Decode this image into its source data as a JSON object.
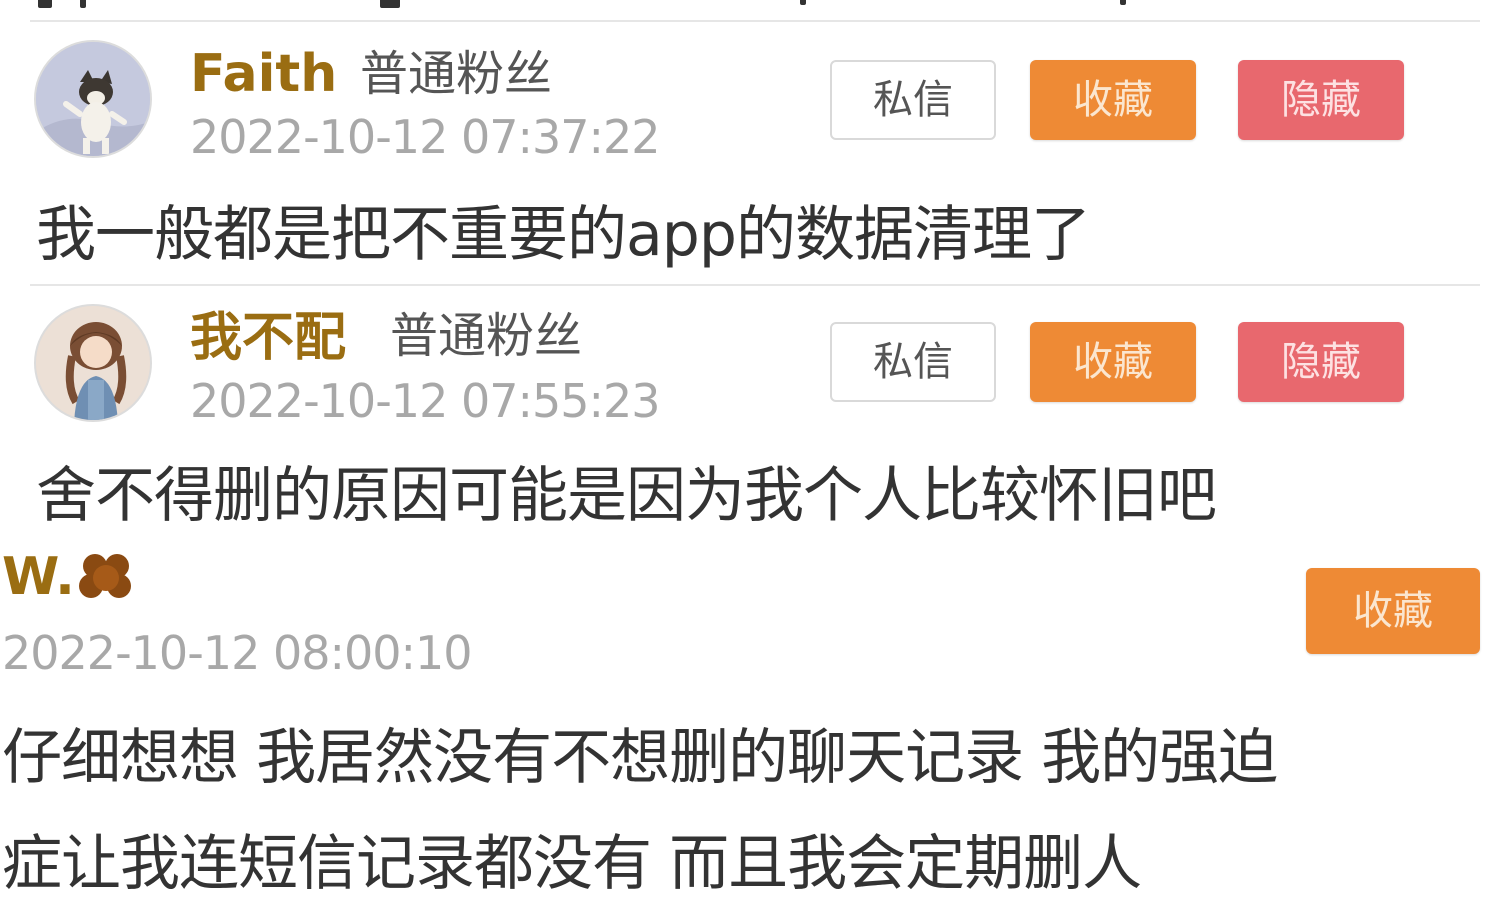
{
  "comments": [
    {
      "username": "Faith",
      "fan_level": "普通粉丝",
      "timestamp": "2022-10-12 07:37:22",
      "content": "我一般都是把不重要的app的数据清理了",
      "buttons": {
        "message": "私信",
        "favorite": "收藏",
        "hide": "隐藏"
      }
    },
    {
      "username": "我不配",
      "fan_level": "普通粉丝",
      "timestamp": "2022-10-12 07:55:23",
      "content": "舍不得删的原因可能是因为我个人比较怀旧吧",
      "buttons": {
        "message": "私信",
        "favorite": "收藏",
        "hide": "隐藏"
      }
    },
    {
      "username": "W.",
      "timestamp": "2022-10-12 08:00:10",
      "content_lines": [
        "仔细想想 我居然没有不想删的聊天记录 我的强迫",
        "症让我连短信记录都没有 而且我会定期删人"
      ],
      "buttons": {
        "favorite": "收藏"
      }
    }
  ],
  "colors": {
    "username": "#9a6d12",
    "favorite_button": "#ee8a35",
    "hide_button": "#e8686e",
    "timestamp": "#a8a8a8"
  },
  "icons": {
    "avatar_1": "avatar-cat-illustration",
    "avatar_2": "avatar-girl-illustration",
    "username_3_emoji": "paw-emoji-icon"
  }
}
